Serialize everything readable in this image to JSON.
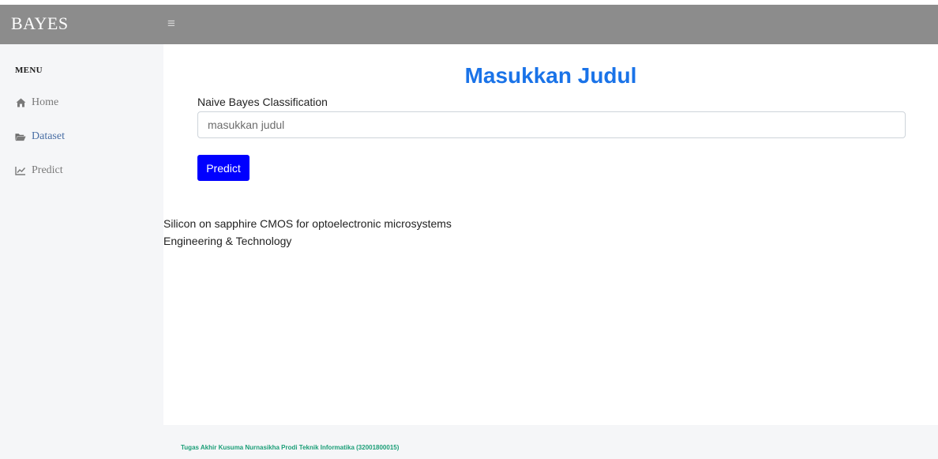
{
  "topbar": {
    "brand": "BAYES",
    "toggle_icon": "hamburger-icon",
    "toggle_glyph": "≡",
    "background": "#8c8c8c"
  },
  "sidebar": {
    "heading": "MENU",
    "items": [
      {
        "label": "Home",
        "icon": "home-icon"
      },
      {
        "label": "Dataset",
        "icon": "folder-icon"
      },
      {
        "label": "Predict",
        "icon": "line-chart-icon"
      }
    ]
  },
  "main": {
    "title": "Masukkan Judul",
    "form_label": "Naive Bayes Classification",
    "input_placeholder": "masukkan judul",
    "input_value": "",
    "predict_label": "Predict",
    "result_title": "Silicon on sapphire CMOS for optoelectronic microsystems",
    "result_category": "Engineering & Technology"
  },
  "footer": {
    "text": "Tugas Akhir Kusuma Nurnasikha Prodi Teknik Informatika (32001800015)"
  },
  "colors": {
    "accent_title": "#1a73e8",
    "button": "#0000ff",
    "footer_text": "#1b9e77"
  }
}
